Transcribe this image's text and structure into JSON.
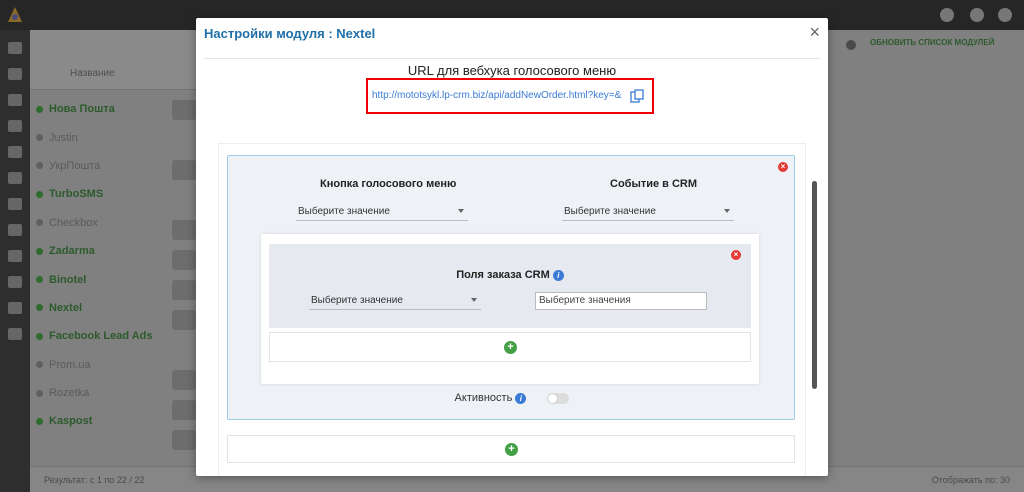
{
  "background": {
    "header_label": "Название",
    "list_items": [
      {
        "label": "Нова Пошта",
        "active": true
      },
      {
        "label": "Justin",
        "active": false
      },
      {
        "label": "УкрПошта",
        "active": false
      },
      {
        "label": "TurboSMS",
        "active": true
      },
      {
        "label": "Checkbox",
        "active": false
      },
      {
        "label": "Zadarma",
        "active": true
      },
      {
        "label": "Binotel",
        "active": true
      },
      {
        "label": "Nextel",
        "active": true
      },
      {
        "label": "Facebook Lead Ads",
        "active": true
      },
      {
        "label": "Prom.ua",
        "active": false
      },
      {
        "label": "Rozetka",
        "active": false
      },
      {
        "label": "Kaspost",
        "active": true
      }
    ],
    "right_button": "ОБНОВИТЬ СПИСОК МОДУЛЕЙ",
    "footer_left": "Результат: с 1 по 22 / 22",
    "footer_right": "Отображать по: 30"
  },
  "modal": {
    "title": "Настройки модуля : Nextel",
    "url_title": "URL для вебхука голосового меню",
    "url_value": "http://mototsykl.lp-crm.biz/api/addNewOrder.html?key=&p",
    "voice_button_label": "Кнопка голосового меню",
    "crm_event_label": "Событие в CRM",
    "select_placeholder": "Выберите значение",
    "order_fields_label": "Поля заказа CRM",
    "order_field_select": "Выберите значение",
    "values_input": "Выберите  значения",
    "activity_label": "Активность",
    "activity_on": false
  }
}
